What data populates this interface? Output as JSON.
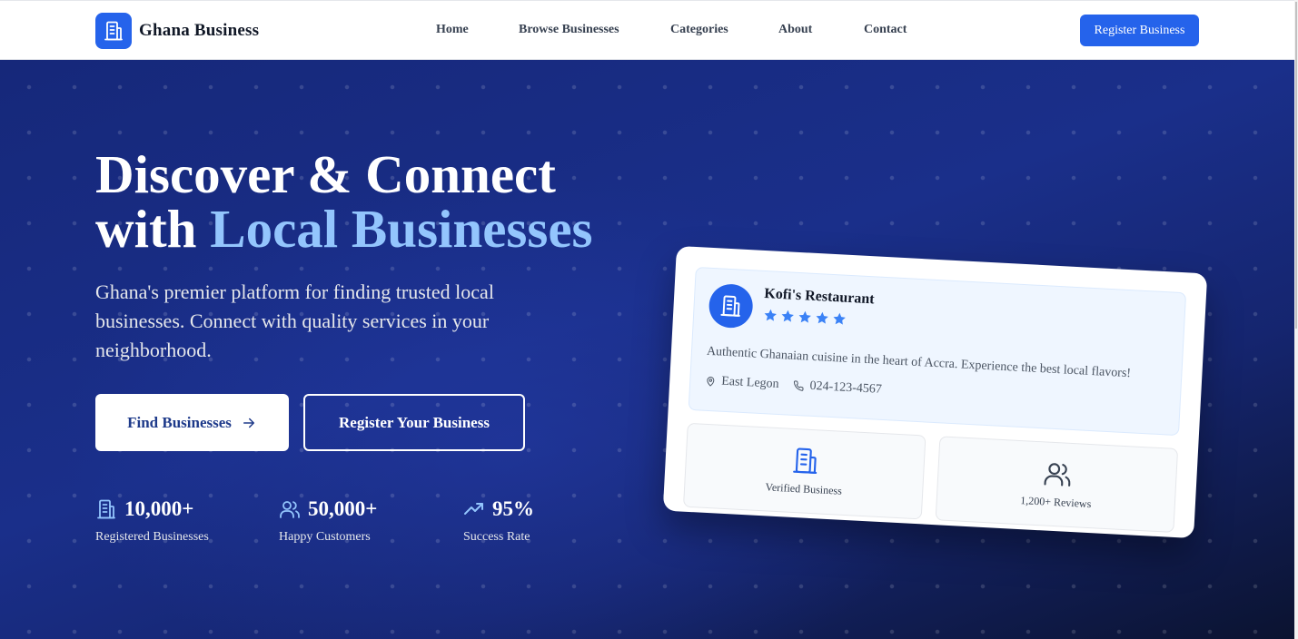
{
  "brand": {
    "name": "Ghana Business",
    "logo_icon": "building-icon",
    "color": "#2563eb"
  },
  "nav": {
    "links": [
      "Home",
      "Browse Businesses",
      "Categories",
      "About",
      "Contact"
    ],
    "cta_label": "Register Business"
  },
  "hero": {
    "title_line1": "Discover & Connect",
    "title_line2_prefix": "with ",
    "title_line2_accent": "Local Businesses",
    "subtitle": "Ghana's premier platform for finding trusted local businesses. Connect with quality services in your neighborhood.",
    "primary_button": "Find Businesses",
    "secondary_button": "Register Your Business",
    "stats": [
      {
        "icon": "building-icon",
        "value": "10,000+",
        "label": "Registered Businesses"
      },
      {
        "icon": "users-icon",
        "value": "50,000+",
        "label": "Happy Customers"
      },
      {
        "icon": "trending-up-icon",
        "value": "95%",
        "label": "Success Rate"
      }
    ]
  },
  "preview_card": {
    "business_name": "Kofi's Restaurant",
    "rating_stars": 5,
    "description": "Authentic Ghanaian cuisine in the heart of Accra. Experience the best local flavors!",
    "location": "East Legon",
    "phone": "024-123-4567",
    "features": [
      {
        "icon": "building-icon",
        "label": "Verified Business"
      },
      {
        "icon": "users-icon",
        "label": "1,200+ Reviews"
      }
    ]
  },
  "colors": {
    "accent": "#93c5fd",
    "hero_bg": "#16287a",
    "star": "#3b82f6"
  }
}
